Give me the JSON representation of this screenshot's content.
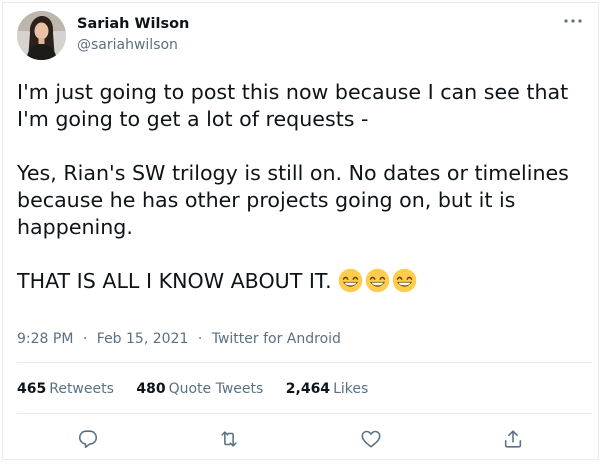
{
  "author": {
    "name": "Sariah Wilson",
    "handle": "@sariahwilson"
  },
  "more_icon": "more-horizontal-icon",
  "tweet": {
    "lines": [
      "I'm just going to post this now because I can see that",
      "I'm going to get a lot of requests -",
      "Yes, Rian's SW trilogy is still on. No dates or timelines",
      "because he has other projects going on, but it is",
      "happening.",
      "THAT IS ALL I KNOW ABOUT IT."
    ],
    "emoji": [
      "grinning-face-icon",
      "grinning-face-icon",
      "grinning-face-icon"
    ]
  },
  "meta": {
    "time": "9:28 PM",
    "separator": "·",
    "date": "Feb 15, 2021",
    "source": "Twitter for Android"
  },
  "stats": {
    "retweets": {
      "count": "465",
      "label": "Retweets"
    },
    "quotes": {
      "count": "480",
      "label": "Quote Tweets"
    },
    "likes": {
      "count": "2,464",
      "label": "Likes"
    }
  },
  "actions": [
    "reply-icon",
    "retweet-icon",
    "like-icon",
    "share-icon"
  ],
  "colors": {
    "text": "#0f1419",
    "secondary": "#5b7083",
    "border": "#e6ecf0",
    "emoji_face": "#ffcc4d",
    "emoji_feature": "#664500"
  }
}
